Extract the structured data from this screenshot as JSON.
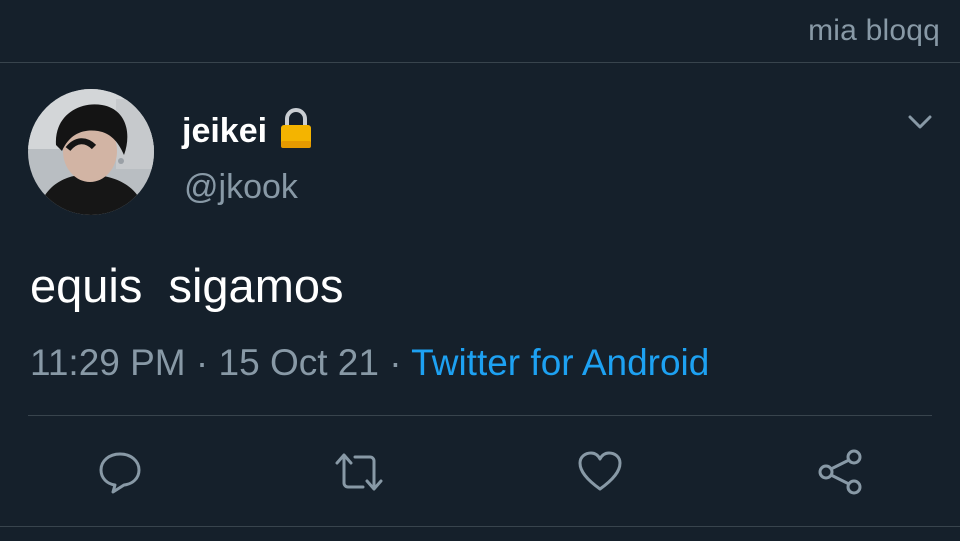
{
  "top_bar": {
    "label": "mia bloqq"
  },
  "tweet": {
    "display_name": "jeikei",
    "handle": "@jkook",
    "protected_icon": "lock-icon",
    "text": "equis  sigamos",
    "time": "11:29 PM",
    "date": "15 Oct 21",
    "separator": " · ",
    "source": "Twitter for Android"
  },
  "actions": [
    {
      "name": "reply",
      "icon": "speech-bubble-icon"
    },
    {
      "name": "retweet",
      "icon": "retweet-icon"
    },
    {
      "name": "like",
      "icon": "heart-icon"
    },
    {
      "name": "share",
      "icon": "share-icon"
    }
  ],
  "colors": {
    "background": "#15202b",
    "secondary_text": "#8899a6",
    "link": "#1da1f2",
    "divider": "#38444d",
    "lock": "#f4b400"
  }
}
